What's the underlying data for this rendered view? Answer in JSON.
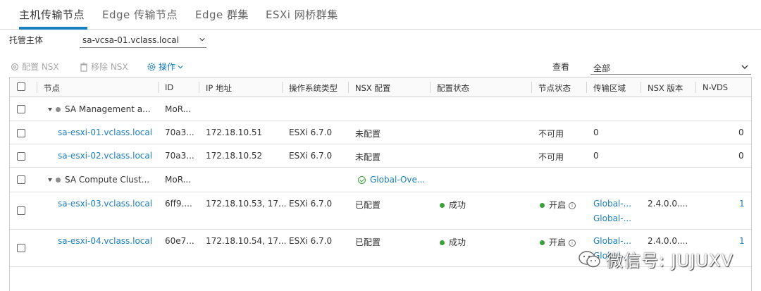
{
  "tabs": [
    {
      "label": "主机传输节点",
      "active": true
    },
    {
      "label": "Edge 传输节点",
      "active": false
    },
    {
      "label": "Edge 群集",
      "active": false
    },
    {
      "label": "ESXi 网桥群集",
      "active": false
    }
  ],
  "host": {
    "label": "托管主体",
    "selected": "sa-vcsa-01.vclass.local"
  },
  "toolbar": {
    "configure_nsx": "配置 NSX",
    "remove_nsx": "移除 NSX",
    "actions": "操作"
  },
  "view": {
    "label": "查看",
    "selected": "全部"
  },
  "columns": [
    "节点",
    "ID",
    "IP 地址",
    "操作系统类型",
    "NSX 配置",
    "配置状态",
    "节点状态",
    "传输区域",
    "NSX 版本",
    "N-VDS"
  ],
  "rows": [
    {
      "type": "cluster",
      "name": "SA Management a...",
      "id": "MoR...",
      "ip": "",
      "os": "",
      "nsx_config": "",
      "config_status": "",
      "node_status": "",
      "tz": "",
      "tz2": "",
      "version": "",
      "nvds": ""
    },
    {
      "type": "host",
      "name": "sa-esxi-01.vclass.local",
      "id": "70a3...",
      "ip": "172.18.10.51",
      "os": "ESXi 6.7.0",
      "nsx_config": "未配置",
      "config_status": "",
      "node_status": "不可用",
      "tz": "0",
      "tz2": "",
      "version": "",
      "nvds": "0"
    },
    {
      "type": "host",
      "name": "sa-esxi-02.vclass.local",
      "id": "70a3...",
      "ip": "172.18.10.52",
      "os": "ESXi 6.7.0",
      "nsx_config": "未配置",
      "config_status": "",
      "node_status": "不可用",
      "tz": "0",
      "tz2": "",
      "version": "",
      "nvds": "0"
    },
    {
      "type": "cluster",
      "name": "SA Compute Clust...",
      "id": "MoR...",
      "ip": "",
      "os": "",
      "nsx_config": "Global-Ove...",
      "config_status": "",
      "node_status": "",
      "tz": "",
      "tz2": "",
      "version": "",
      "nvds": ""
    },
    {
      "type": "host",
      "name": "sa-esxi-03.vclass.local",
      "id": "6ff9....",
      "ip": "172.18.10.53, 17...",
      "os": "ESXi 6.7.0",
      "nsx_config": "已配置",
      "config_status": "成功",
      "node_status": "开启",
      "tz": "Global-...",
      "tz2": "Global-...",
      "version": "2.4.0.0....",
      "nvds": "1"
    },
    {
      "type": "host",
      "name": "sa-esxi-04.vclass.local",
      "id": "60e7...",
      "ip": "172.18.10.54, 17...",
      "os": "ESXi 6.7.0",
      "nsx_config": "已配置",
      "config_status": "成功",
      "node_status": "开启",
      "tz": "Global-...",
      "tz2": "Global-...",
      "version": "2.4.0.0....",
      "nvds": "1"
    }
  ],
  "watermark": "微信号: JUJUXV"
}
